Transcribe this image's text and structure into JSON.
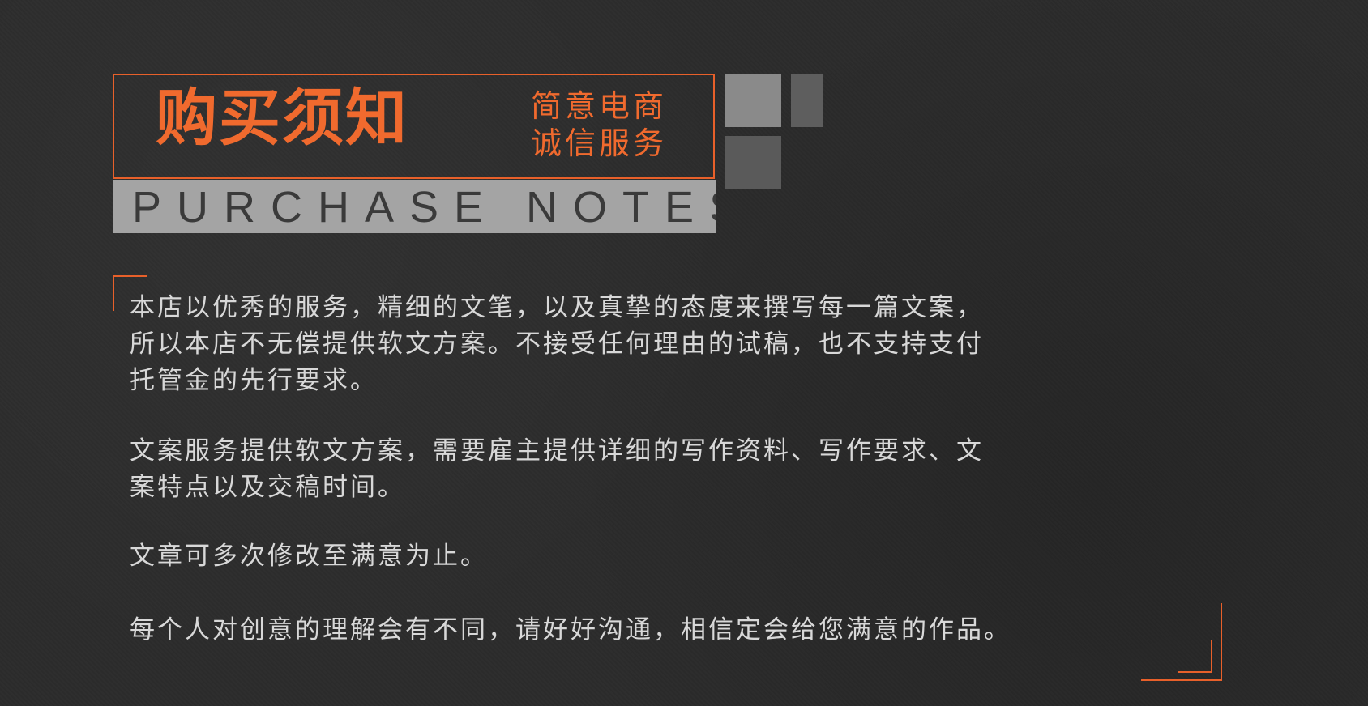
{
  "header": {
    "title": "购买须知",
    "subtitle_line1": "简意电商",
    "subtitle_line2": "诚信服务",
    "english_band": "PURCHASE NOTES"
  },
  "content": {
    "paragraph1_line1": "本店以优秀的服务，精细的文笔，以及真挚的态度来撰写每一篇文案，",
    "paragraph1_line2": "所以本店不无偿提供软文方案。不接受任何理由的试稿，也不支持支付",
    "paragraph1_line3": "托管金的先行要求。",
    "paragraph2_line1": "文案服务提供软文方案，需要雇主提供详细的写作资料、写作要求、文",
    "paragraph2_line2": "案特点以及交稿时间。",
    "paragraph3": "文章可多次修改至满意为止。",
    "paragraph4": "每个人对创意的理解会有不同，请好好沟通，相信定会给您满意的作品。"
  },
  "colors": {
    "accent": "#f06a2e",
    "background": "#2c2c2c",
    "band": "#a4a4a4",
    "text": "#d8d8d8"
  }
}
